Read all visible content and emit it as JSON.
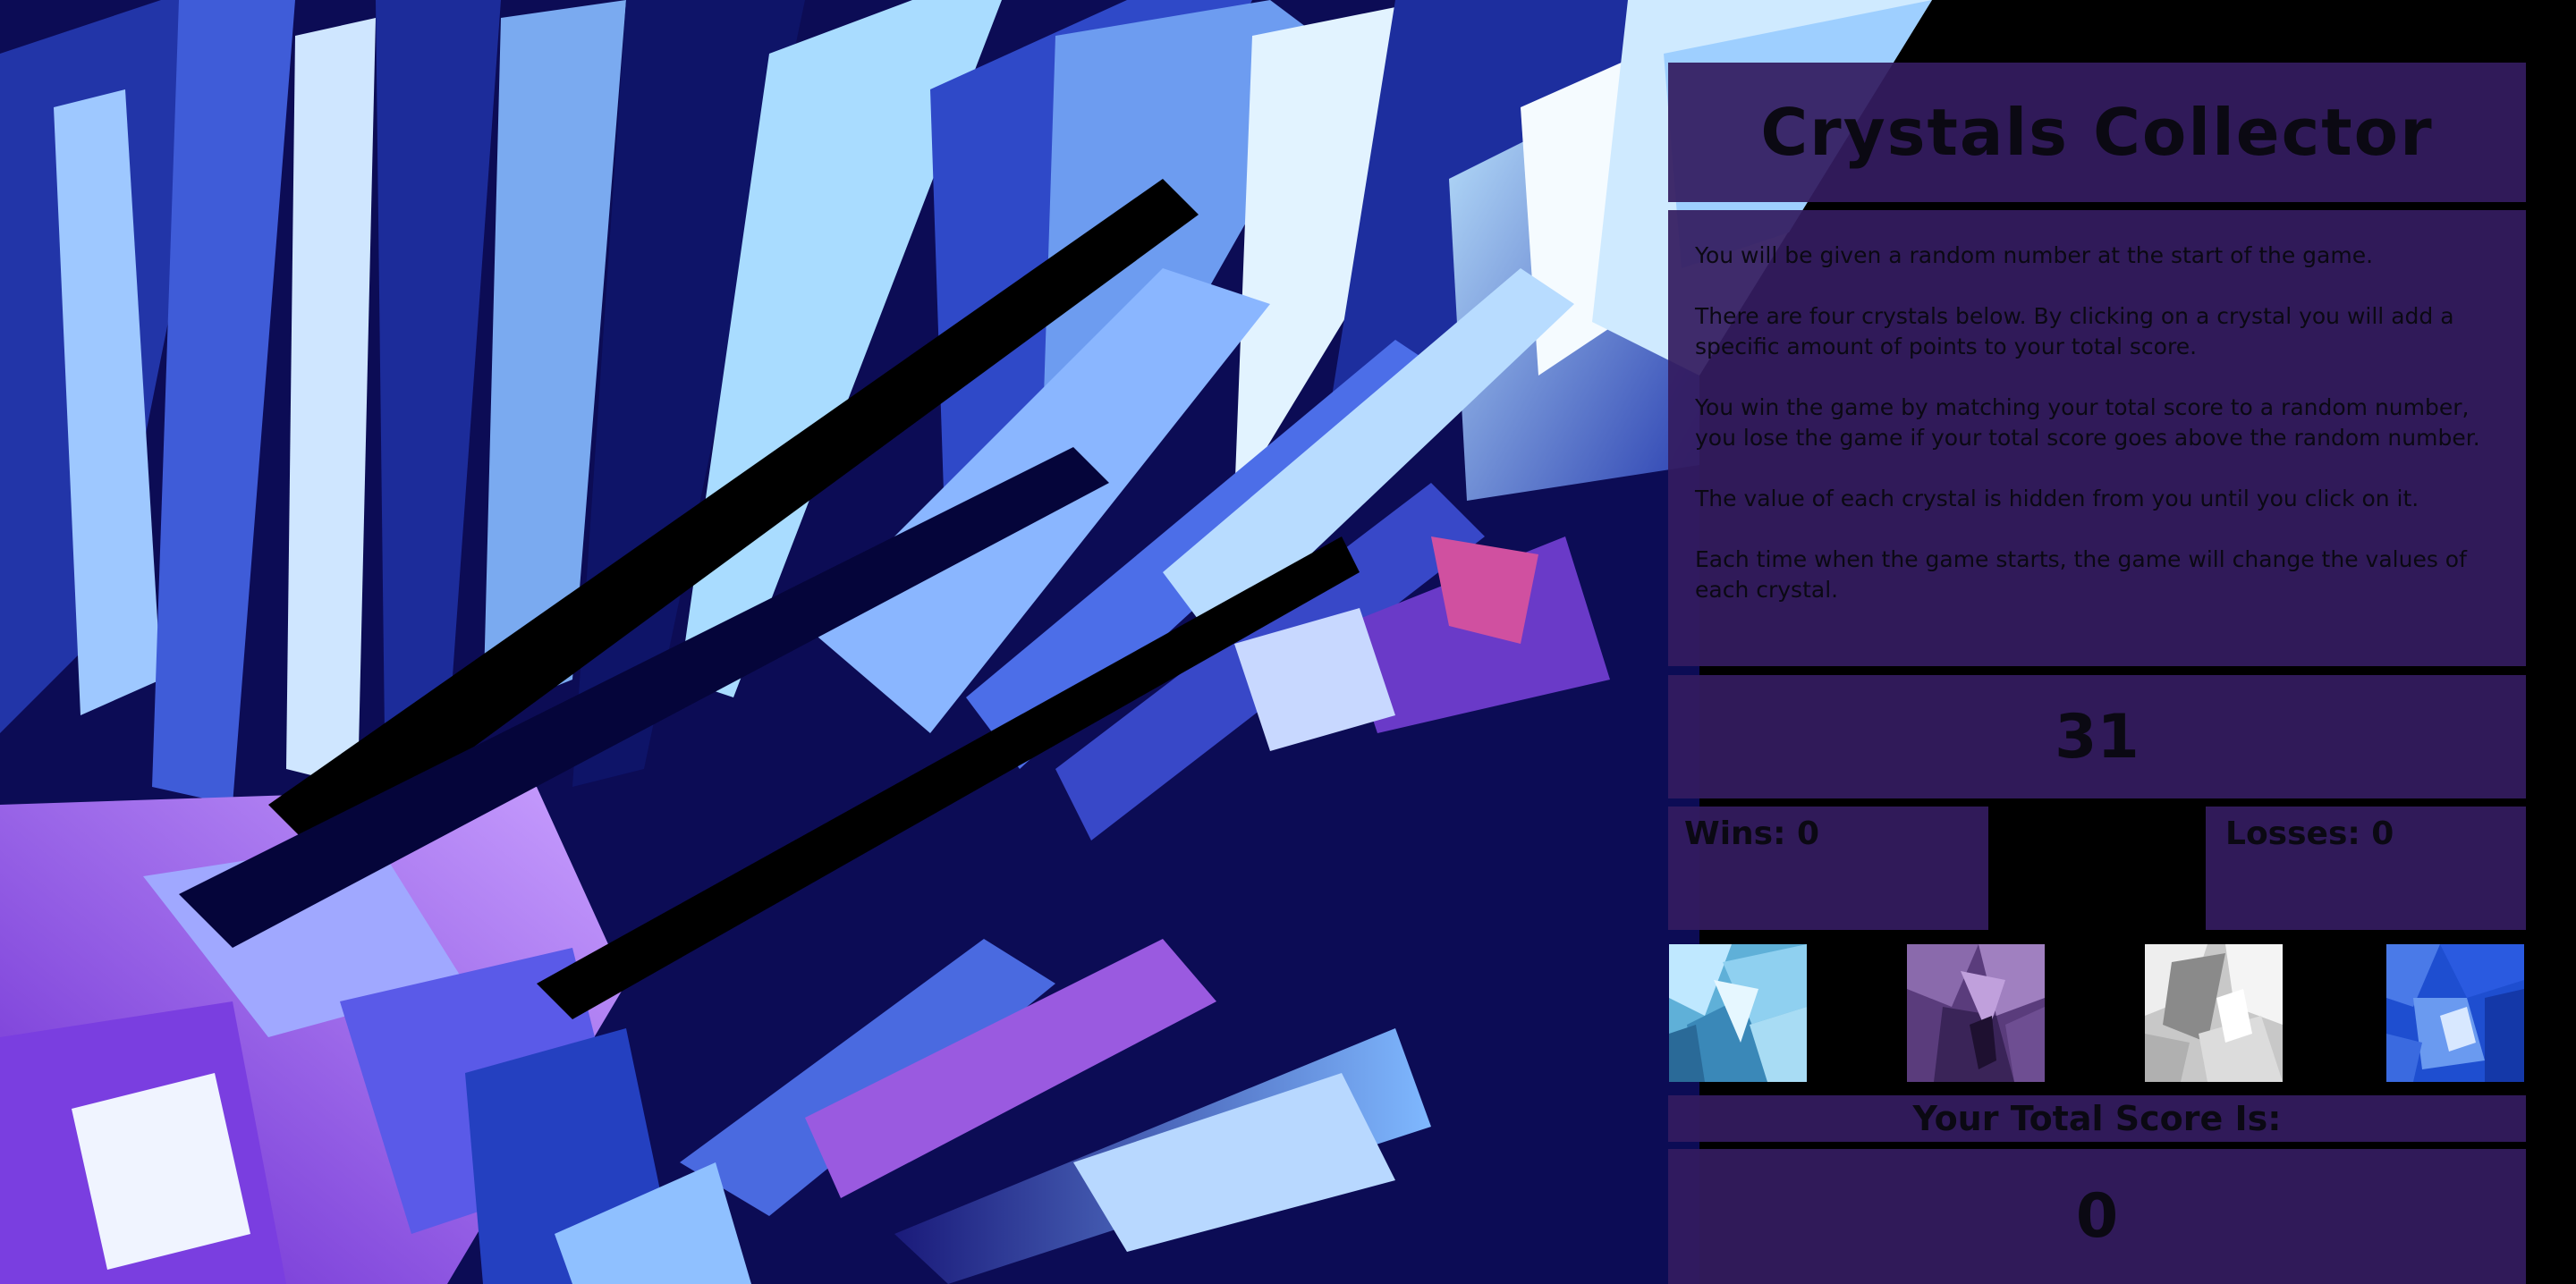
{
  "title": "Crystals Collector",
  "instructions": [
    "You will be given a random number at the start of the game.",
    "There are four crystals below. By clicking on a crystal you will add a specific amount of points to your total score.",
    "You win the game by matching your total score to a random number, you lose the game if your total score goes above the random number.",
    "The value of each crystal is hidden from you until you click on it.",
    "Each time when the game starts, the game will change the values of each crystal."
  ],
  "target_number": "31",
  "wins_label": "Wins: 0",
  "losses_label": "Losses: 0",
  "crystals": [
    {
      "name": "crystal-light-blue",
      "color": "#7ec8e8"
    },
    {
      "name": "crystal-purple",
      "color": "#6a4a8c"
    },
    {
      "name": "crystal-white",
      "color": "#d8d8d8"
    },
    {
      "name": "crystal-blue",
      "color": "#2a5ad8"
    }
  ],
  "score_label": "Your Total Score Is:",
  "score_value": "0",
  "colors": {
    "panel": "#341c60",
    "text": "#0b0913",
    "background": "#000000"
  }
}
